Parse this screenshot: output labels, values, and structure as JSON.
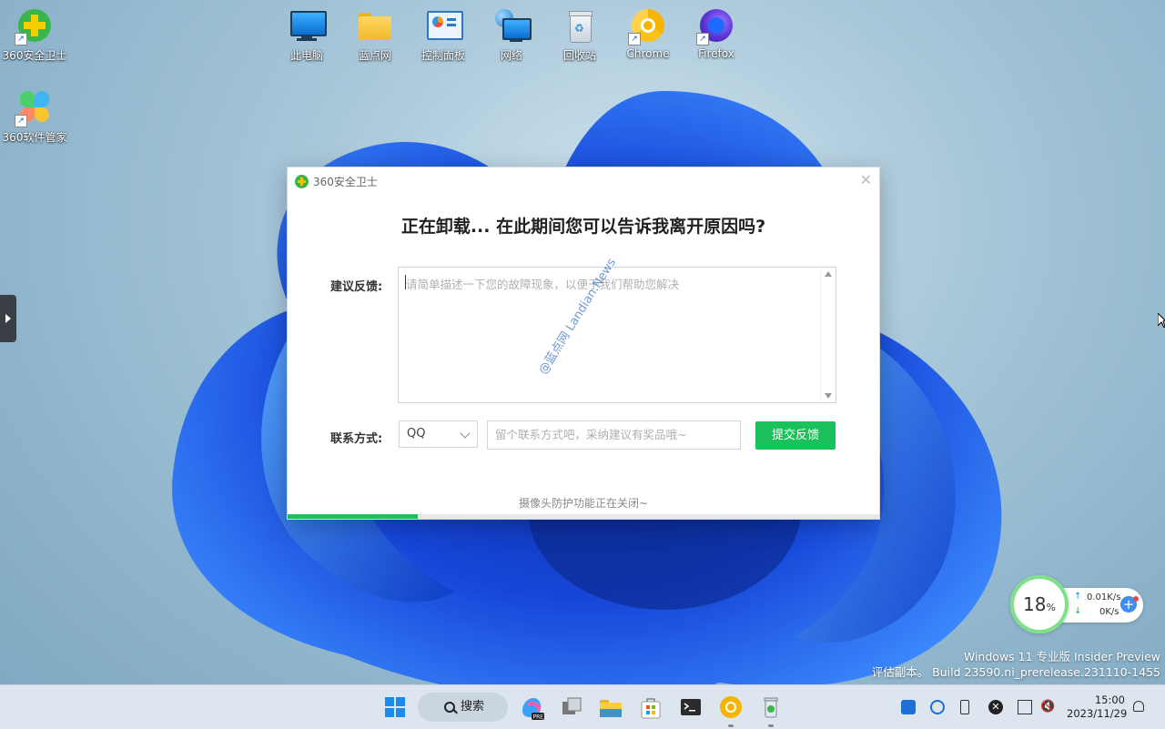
{
  "desktop": {
    "icons": [
      {
        "label": "360安全卫士",
        "icon": "360-safe-icon"
      },
      {
        "label": "此电脑",
        "icon": "computer-icon"
      },
      {
        "label": "蓝点网",
        "icon": "folder-icon"
      },
      {
        "label": "控制面板",
        "icon": "control-panel-icon"
      },
      {
        "label": "网络",
        "icon": "network-icon"
      },
      {
        "label": "回收站",
        "icon": "recycle-bin-icon"
      },
      {
        "label": "Chrome",
        "icon": "chrome-icon"
      },
      {
        "label": "Firefox",
        "icon": "firefox-icon"
      },
      {
        "label": "360软件管家",
        "icon": "360-software-manager-icon"
      }
    ]
  },
  "dialog": {
    "title": "360安全卫士",
    "heading": "正在卸载... 在此期间您可以告诉我离开原因吗?",
    "feedback_label": "建议反馈:",
    "feedback_placeholder": "请简单描述一下您的故障现象，以便于我们帮助您解决",
    "watermark": "@蓝点网 Landian.News",
    "contact_label": "联系方式:",
    "contact_type": "QQ",
    "contact_placeholder": "留个联系方式吧，采纳建议有奖品哦~",
    "submit_label": "提交反馈",
    "status": "摄像头防护功能正在关闭~",
    "progress": 0.22
  },
  "widget": {
    "percent": "18",
    "percent_unit": "%",
    "upload": "0.01K/s",
    "download": "0K/s"
  },
  "os_watermark": {
    "line1": "Windows 11 专业版 Insider Preview",
    "line2": "评估副本。 Build 23590.ni_prerelease.231110-1455"
  },
  "taskbar": {
    "search_label": "搜索",
    "time": "15:00",
    "date": "2023/11/29"
  },
  "colors": {
    "accent_green": "#1bc25b",
    "taskbar_bg": "#dde6ee"
  }
}
